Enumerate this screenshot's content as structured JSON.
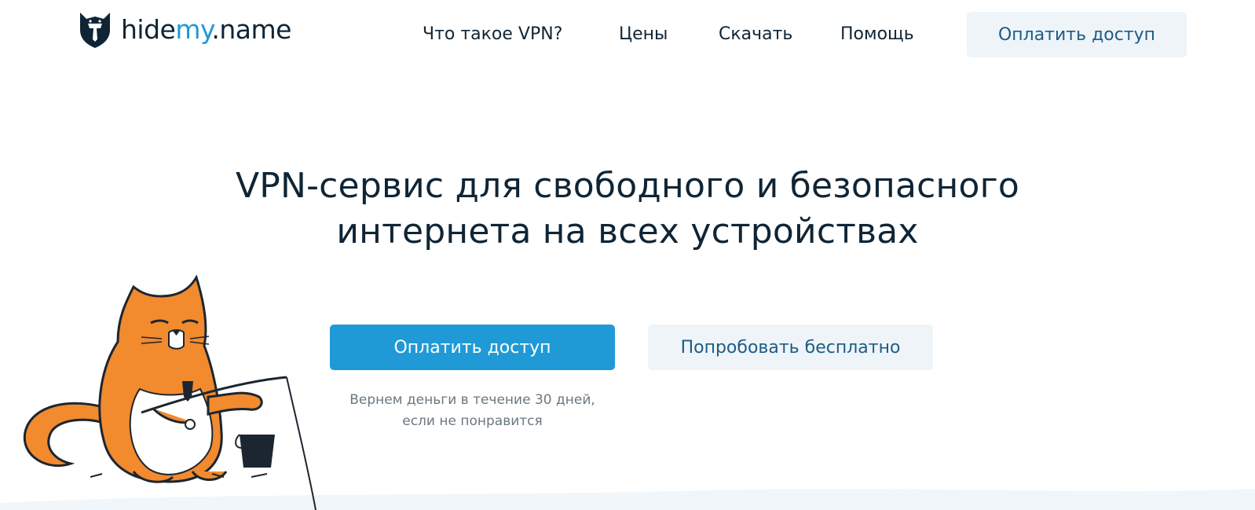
{
  "header": {
    "logo": {
      "prefix": "hide",
      "accent": "my",
      "suffix": ".name"
    },
    "nav": [
      {
        "label": "Что такое VPN?"
      },
      {
        "label": "Цены"
      },
      {
        "label": "Скачать"
      },
      {
        "label": "Помощь"
      }
    ],
    "cta_label": "Оплатить доступ"
  },
  "hero": {
    "headline_line1": "VPN-сервис для свободного и безопасного",
    "headline_line2": "интернета на всех устройствах",
    "primary_button": "Оплатить доступ",
    "secondary_button": "Попробовать бесплатно",
    "guarantee_line1": "Вернем деньги в течение 30 дней,",
    "guarantee_line2": "если не понравится"
  },
  "colors": {
    "accent": "#1f9ad6",
    "text_dark": "#0f2536",
    "button_light_bg": "#eef4f8",
    "button_light_text": "#1d5c86",
    "cat_orange": "#f28a2e"
  },
  "icons": {
    "logo": "cat-shield-logo-icon",
    "illustration": "fishing-cat-illustration"
  }
}
